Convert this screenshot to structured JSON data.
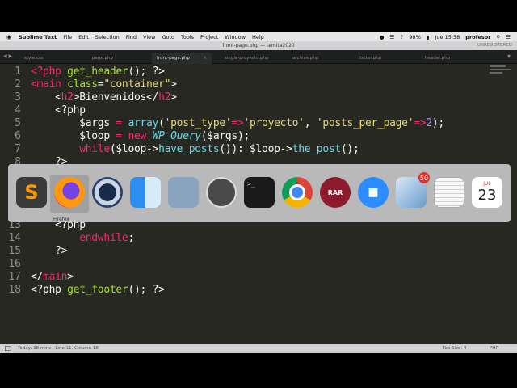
{
  "menubar": {
    "apple": "",
    "items": [
      "Sublime Text",
      "File",
      "Edit",
      "Selection",
      "Find",
      "View",
      "Goto",
      "Tools",
      "Project",
      "Window",
      "Help"
    ],
    "battery": "98%",
    "clock": "Jue 15:58",
    "user": "profesor"
  },
  "window": {
    "title": "front-page.php — temita2020",
    "unregistered": "UNREGISTERED"
  },
  "tabs": [
    {
      "label": "style.css"
    },
    {
      "label": "page.php"
    },
    {
      "label": "front-page.php"
    },
    {
      "label": "single-proyecto.php"
    },
    {
      "label": "archive.php"
    },
    {
      "label": "footer.php"
    },
    {
      "label": "header.php"
    }
  ],
  "editor": {
    "line_numbers": [
      "1",
      "2",
      "3",
      "4",
      "5",
      "6",
      "7",
      "8",
      "13",
      "14",
      "15",
      "16",
      "17",
      "18"
    ]
  },
  "dock": {
    "tooltip": "Firefox",
    "apps": [
      {
        "name": "Sublime Text",
        "icon": "sublime-icon",
        "color": "#4d4d4d"
      },
      {
        "name": "Firefox",
        "icon": "firefox-icon",
        "color": "#ff7139"
      },
      {
        "name": "QuickTime Player",
        "icon": "quicktime-icon",
        "color": "#2a3f6a"
      },
      {
        "name": "Finder",
        "icon": "finder-icon",
        "color": "#3b9cf0"
      },
      {
        "name": "Preview",
        "icon": "preview-icon",
        "color": "#8aa4c0"
      },
      {
        "name": "MAMP",
        "icon": "mamp-icon",
        "color": "#555555"
      },
      {
        "name": "Terminal",
        "icon": "terminal-icon",
        "color": "#1a1a1a"
      },
      {
        "name": "Chrome",
        "icon": "chrome-icon",
        "color": "#e8e8e8"
      },
      {
        "name": "RAR Extractor",
        "icon": "rar-icon",
        "color": "#8c1b2e"
      },
      {
        "name": "Zoom",
        "icon": "zoom-icon",
        "color": "#2d8cff"
      },
      {
        "name": "Mail",
        "icon": "mail-icon",
        "color": "#9fc0e0",
        "badge": "50"
      },
      {
        "name": "TextEdit",
        "icon": "textedit-icon",
        "color": "#f4f4f4"
      },
      {
        "name": "Calendar",
        "icon": "calendar-icon",
        "color": "#ffffff",
        "month": "JUL",
        "day": "23"
      }
    ]
  },
  "statusbar": {
    "left": "Today: 38 mins , Line 11, Column 18",
    "tab_size": "Tab Size: 4",
    "syntax": "PHP"
  }
}
